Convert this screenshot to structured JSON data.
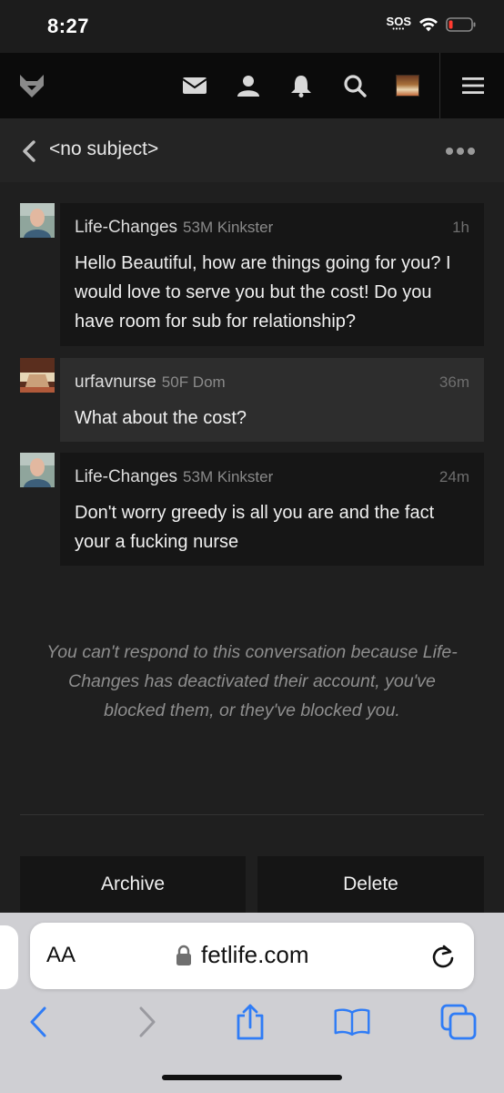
{
  "status": {
    "time": "8:27",
    "sos": "SOS"
  },
  "nav": {
    "icons": [
      "fox-logo-icon",
      "mail-icon",
      "person-icon",
      "bell-icon",
      "search-icon",
      "avatar",
      "hamburger-menu-icon"
    ]
  },
  "conversation": {
    "subject": "<no subject>",
    "messages": [
      {
        "user": "Life-Changes",
        "meta": "53M Kinkster",
        "time": "1h",
        "body": "Hello Beautiful, how are things going for you? I would love to serve you but the cost! Do you have room for sub for relationship?"
      },
      {
        "user": "urfavnurse",
        "meta": "50F Dom",
        "time": "36m",
        "body": "What about the cost?"
      },
      {
        "user": "Life-Changes",
        "meta": "53M Kinkster",
        "time": "24m",
        "body": "Don't worry greedy is all you are and the fact your a fucking nurse"
      }
    ],
    "notice": "You can't respond to this conversation because Life-Changes has deactivated their account, you've blocked them, or they've blocked you.",
    "archive_label": "Archive",
    "delete_label": "Delete"
  },
  "browser": {
    "text_size_label": "AA",
    "url": "fetlife.com"
  },
  "colors": {
    "background": "#1f1f1f",
    "nav": "#0b0b0b",
    "accent_ios": "#2f7cf6"
  }
}
